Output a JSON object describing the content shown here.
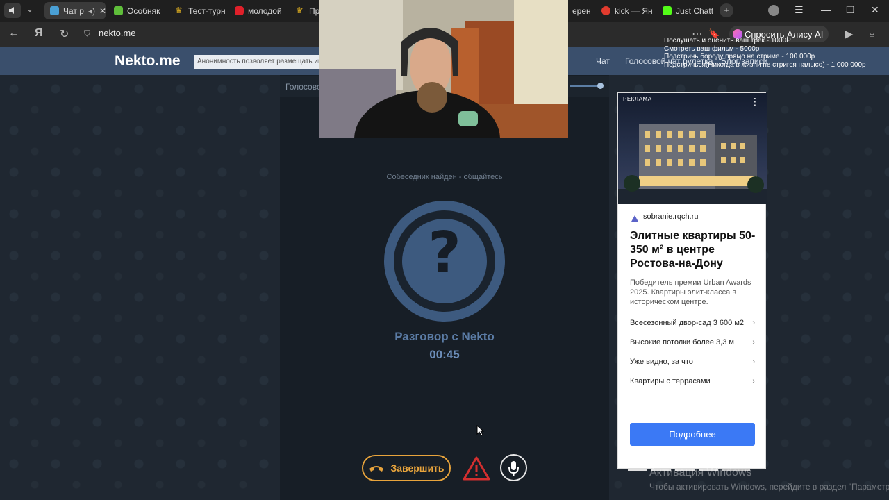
{
  "browser": {
    "tabs": [
      {
        "label": "Чат р",
        "active": true,
        "color": "#4aa0d5"
      },
      {
        "label": "Особняк",
        "color": "#5fbe3a"
      },
      {
        "label": "Тест-турн",
        "color": "#e0b020"
      },
      {
        "label": "молодой",
        "color": "#e0202a"
      },
      {
        "label": "Пр",
        "color": "#e0b020"
      },
      {
        "label": "ерен",
        "color": "#888888"
      },
      {
        "label": "kick — Ян",
        "color": "#e23b2e"
      },
      {
        "label": "Just Chatt",
        "color": "#53fc18"
      }
    ],
    "url": "nekto.me",
    "alice_label": "Спросить Алису AI"
  },
  "overlay": {
    "lines": [
      "Послушать и оценить ваш трек - 1000Р",
      "Смотреть ваш фильм - 5000р",
      "Подстричь бороду прямо на стриме - 100 000р",
      "Подстричься(Никогда в жизни не стригся налысо) - 1 000 000р"
    ]
  },
  "header": {
    "logo": "Nekto.me",
    "ticker": "Анонимность позволяет размещать инф",
    "links": [
      "Чат",
      "Голосовой чат рулетка",
      "Блог/записи"
    ]
  },
  "chat": {
    "subbar": "Голосово",
    "found": "Собеседник найден - общайтесь",
    "title": "Разговор с Nekto",
    "timer": "00:45",
    "end_label": "Завершить",
    "accent": "#e8a43c"
  },
  "ad": {
    "label": "РЕКЛАМА",
    "domain": "sobranie.rqch.ru",
    "title": "Элитные квартиры 50-350 м² в центре Ростова-на-Дону",
    "desc": "Победитель премии Urban Awards 2025. Квартиры элит-класса в историческом центре.",
    "items": [
      "Всесезонный двор-сад 3 600 м2",
      "Высокие потолки более 3,3 м",
      "Уже видно, за что",
      "Квартиры с террасами"
    ],
    "cta": "Подробнее"
  },
  "watermark": {
    "title": "Активация Windows",
    "sub": "Чтобы активировать Windows, перейдите в раздел \"Параметры\"."
  }
}
